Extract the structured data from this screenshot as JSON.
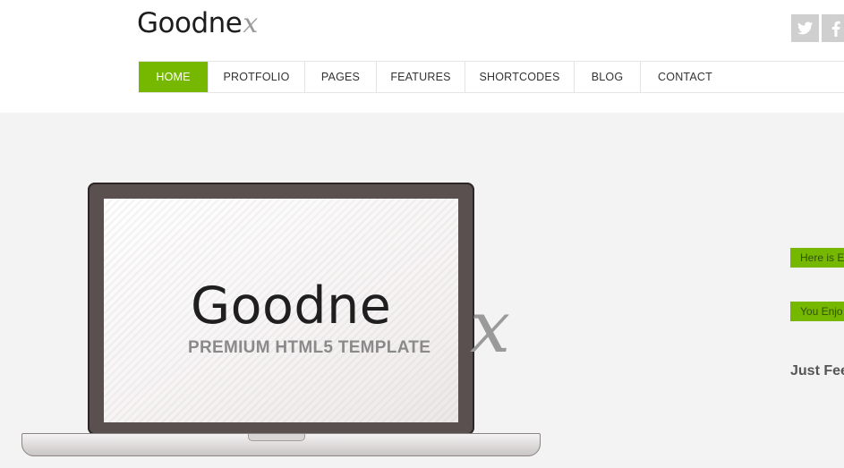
{
  "header": {
    "logo_main": "Goodne",
    "logo_x": "x",
    "social": [
      {
        "icon": "twitter-icon"
      },
      {
        "icon": "facebook-icon"
      }
    ]
  },
  "nav": {
    "items": [
      {
        "label": "HOME",
        "active": true
      },
      {
        "label": "PROTFOLIO"
      },
      {
        "label": "PAGES"
      },
      {
        "label": "FEATURES"
      },
      {
        "label": "SHORTCODES"
      },
      {
        "label": "BLOG"
      },
      {
        "label": "CONTACT"
      }
    ]
  },
  "hero": {
    "logo_main": "Goodne",
    "logo_x": "x",
    "tagline": "PREMIUM HTML5 TEMPLATE",
    "side_label_1": "Here is E",
    "side_label_2": "You Enjo",
    "side_text": "Just Fee"
  },
  "colors": {
    "accent": "#76b800",
    "hero_bg": "#f3f3f3"
  }
}
